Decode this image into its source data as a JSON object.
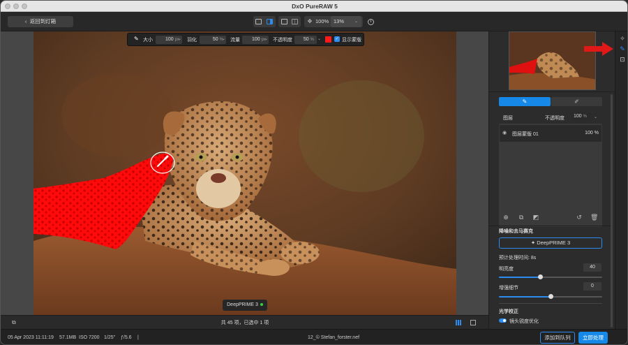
{
  "window": {
    "title": "DxO PureRAW 5"
  },
  "toolbar": {
    "back_label": "返回到灯箱",
    "zoom_percent": "100%",
    "zoom_select": "13%"
  },
  "brushbar": {
    "size_label": "大小",
    "size_value": "100",
    "size_unit": "px",
    "feather_label": "羽化",
    "feather_value": "50",
    "feather_unit": "%",
    "flow_label": "流量",
    "flow_value": "100",
    "flow_unit": "px",
    "opacity_label": "不透明度",
    "opacity_value": "50",
    "opacity_unit": "%",
    "mask_color": "#ff1a1a",
    "show_mask_label": "显示蒙版"
  },
  "canvas": {
    "tag_label": "DeepPRIME 3",
    "mask_color": "#ff0000"
  },
  "filmstrip": {
    "count_text": "共 45 项，已选中 1 项"
  },
  "status": {
    "date": "05 Apr 2023 11:11:19",
    "size": "57.1MB",
    "iso": "ISO 7200",
    "shutter": "1/25\"",
    "aperture": "ƒ/5.6",
    "separator": "|",
    "filename": "12_© Stefan_forster.nef",
    "add_queue_label": "添加到队列",
    "process_label": "立即处理"
  },
  "panel": {
    "layers_label": "图层",
    "opacity_label": "不透明度",
    "opacity_value": "100",
    "opacity_unit": "%",
    "layer_name": "图层蒙版 01",
    "layer_opacity": "100 %",
    "denoise_heading": "降噪和去马赛克",
    "denoise_button": "✦ DeepPRIME 3",
    "eta_label": "预计处理时间: 8s",
    "brightness_label": "明亮度",
    "brightness_value": "40",
    "brightness_fraction": 0.4,
    "detail_label": "增强细节",
    "detail_value": "0",
    "detail_fraction": 0.5,
    "optics_heading": "光学校正",
    "lens_sharpen_label": "镜头锐度优化"
  },
  "colors": {
    "accent": "#2d8cf0",
    "process_button": "#1689e8",
    "annotation_arrow": "#e01818"
  }
}
